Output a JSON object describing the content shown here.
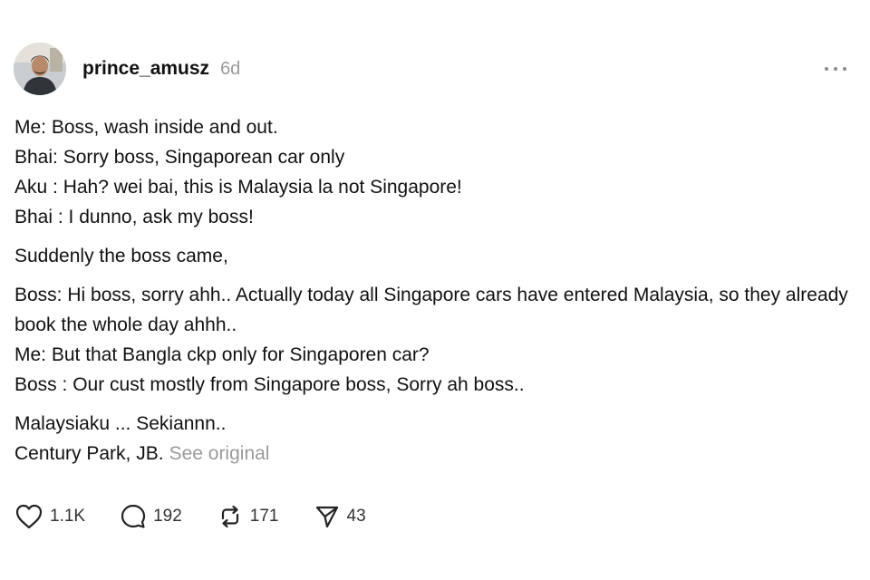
{
  "post": {
    "author": {
      "username": "prince_amusz",
      "avatar_icon": "avatar-photo"
    },
    "timestamp": "6d",
    "more_icon": "more-horizontal-icon",
    "paragraphs": [
      {
        "lines": [
          "Me: Boss, wash inside and out.",
          "Bhai: Sorry boss, Singaporean car only",
          "Aku : Hah? wei bai, this is Malaysia la not Singapore!",
          "Bhai : I dunno, ask my boss!"
        ]
      },
      {
        "lines": [
          "Suddenly the boss came,"
        ]
      },
      {
        "lines": [
          "Boss: Hi boss, sorry ahh.. Actually today all Singapore cars have entered Malaysia, so they already book the whole day ahhh..",
          "Me: But that Bangla ckp only for Singaporen car?",
          "Boss : Our cust mostly from Singapore boss, Sorry ah boss.."
        ]
      },
      {
        "lines": [
          "Malaysiaku ... Sekiannn..",
          "Century Park, JB."
        ]
      }
    ],
    "see_original_label": "See original",
    "actions": {
      "likes": {
        "icon": "heart-icon",
        "count": "1.1K"
      },
      "replies": {
        "icon": "comment-icon",
        "count": "192"
      },
      "reposts": {
        "icon": "repost-icon",
        "count": "171"
      },
      "shares": {
        "icon": "send-icon",
        "count": "43"
      }
    }
  }
}
